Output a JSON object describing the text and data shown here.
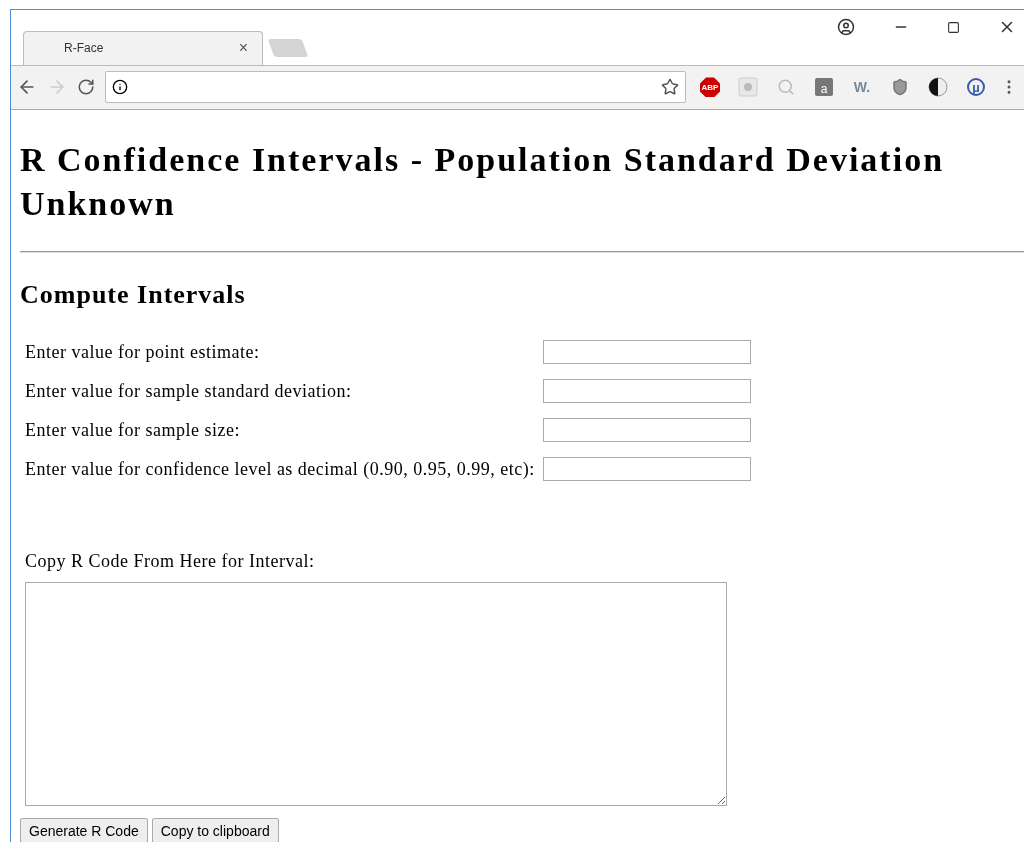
{
  "browser": {
    "tab": {
      "title": "R-Face",
      "close": "×"
    },
    "extensions": [
      {
        "kind": "abp",
        "label": "ABP"
      },
      {
        "kind": "record"
      },
      {
        "kind": "zoom"
      },
      {
        "kind": "bag",
        "label": "a"
      },
      {
        "kind": "w",
        "label": "W."
      },
      {
        "kind": "shield"
      },
      {
        "kind": "contrast"
      },
      {
        "kind": "micro",
        "label": "µ"
      }
    ]
  },
  "page": {
    "title": "R Confidence Intervals - Population Standard Deviation Unknown",
    "section": "Compute Intervals",
    "fields": [
      {
        "label": "Enter value for point estimate:"
      },
      {
        "label": "Enter value for sample standard deviation:"
      },
      {
        "label": "Enter value for sample size:"
      },
      {
        "label": "Enter value for confidence level as decimal (0.90, 0.95, 0.99, etc):"
      }
    ],
    "code_label": "Copy R Code From Here for Interval:",
    "buttons": [
      "Generate R Code",
      "Copy to clipboard"
    ]
  }
}
